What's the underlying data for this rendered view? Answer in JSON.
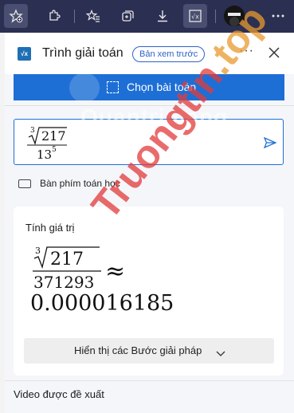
{
  "toolbar": {
    "icons": [
      "favorites-add-icon",
      "extensions-icon",
      "favorites-icon",
      "collections-icon",
      "downloads-icon",
      "math-solver-icon",
      "profile-avatar"
    ]
  },
  "header": {
    "title": "Trình giải toán",
    "badge": "Bản xem trước",
    "more": "···"
  },
  "choose_button": {
    "label": "Chọn bài toán"
  },
  "input": {
    "root_index": "3",
    "radicand": "217",
    "den_base": "13",
    "den_exp": "5"
  },
  "keyboard": {
    "label": "Bàn phím toán học"
  },
  "result": {
    "heading": "Tính giá trị",
    "root_index": "3",
    "radicand": "217",
    "denominator": "371293",
    "approx": "≈",
    "decimal": "0.000016185",
    "steps_label": "Hiển thị các Bước giải pháp"
  },
  "video": {
    "heading": "Video được đề xuất"
  },
  "watermarks": {
    "top": "Quantrimang",
    "diag_main": "Truongtin",
    "diag_tld": ".top"
  },
  "colors": {
    "toolbar": "#2b2f52",
    "accent": "#1d6fd6",
    "watermark_red": "#e23b3b"
  }
}
